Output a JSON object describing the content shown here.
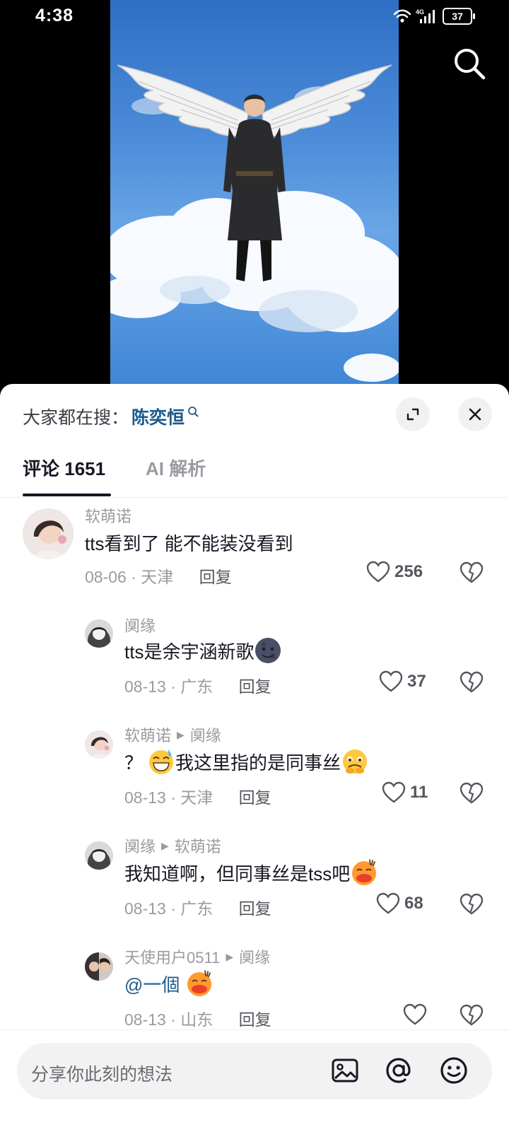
{
  "status_bar": {
    "time": "4:38",
    "network": "4G",
    "battery": "37"
  },
  "hot_search": {
    "prefix": "大家都在搜：",
    "term": "陈奕恒"
  },
  "tabs": [
    {
      "label": "评论",
      "count": "1651",
      "active": true
    },
    {
      "label": "AI 解析",
      "active": false
    }
  ],
  "comments": [
    {
      "user": "软萌诺",
      "reply_to": "",
      "text": "tts看到了 能不能装没看到",
      "emoji": "",
      "date": "08-06",
      "location": "天津",
      "reply_label": "回复",
      "likes": "256"
    },
    {
      "user": "阒缘",
      "reply_to": "",
      "text": "tts是余宇涵新歌",
      "emoji": "new-moon-face",
      "date": "08-13",
      "location": "广东",
      "reply_label": "回复",
      "likes": "37"
    },
    {
      "user": "软萌诺",
      "reply_to": "阒缘",
      "text_prefix": "？",
      "emoji_1": "grinning-sweat-face",
      "text": "我这里指的是同事丝",
      "emoji": "holding-back-tears-face",
      "date": "08-13",
      "location": "天津",
      "reply_label": "回复",
      "likes": "11"
    },
    {
      "user": "阒缘",
      "reply_to": "软萌诺",
      "text": "我知道啊，但同事丝是tss吧",
      "emoji": "shy-blush-face",
      "date": "08-13",
      "location": "广东",
      "reply_label": "回复",
      "likes": "68"
    },
    {
      "user": "天使用户0511",
      "reply_to": "阒缘",
      "text": "@一個",
      "emoji": "shy-blush-face",
      "date": "08-13",
      "location": "山东",
      "reply_label": "回复",
      "likes": ""
    }
  ],
  "input": {
    "placeholder": "分享你此刻的想法"
  },
  "colors": {
    "link": "#1e5a8a",
    "muted": "#9a9ba1",
    "text": "#161823",
    "sky": "#3f86d6"
  }
}
